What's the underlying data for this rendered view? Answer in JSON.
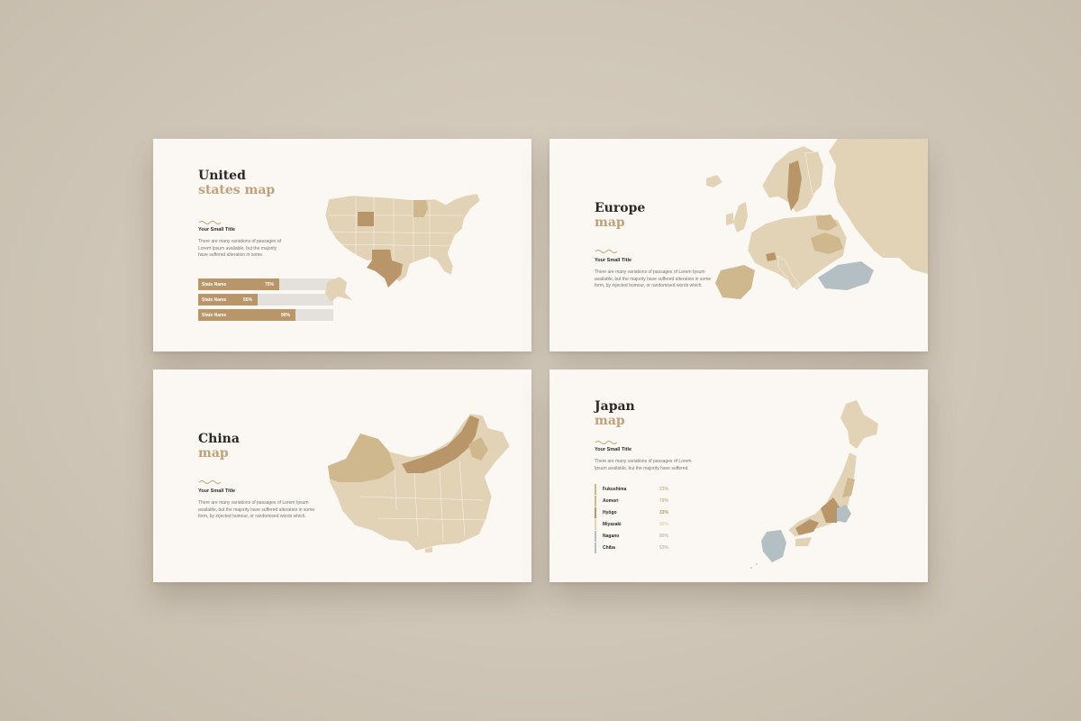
{
  "colors": {
    "background": "#d3cabb",
    "slide": "#fbf8f3",
    "map_light": "#e2d3b6",
    "map_mid": "#cfb78e",
    "map_dark": "#b8966a",
    "map_blue": "#b3bfc3",
    "title_dark": "#2d2824",
    "title_gold": "#bfa27a"
  },
  "slides": {
    "us": {
      "title_line1": "United",
      "title_line2": "states map",
      "small_title": "Your Small Title",
      "body": "There are many variations of passages of Lorem Ipsum available, but the majority have suffered alteration in some.",
      "bars": [
        {
          "label": "State Name",
          "pct_text": "75%",
          "value": 0.75
        },
        {
          "label": "State Name",
          "pct_text": "55%",
          "value": 0.55
        },
        {
          "label": "State Name",
          "pct_text": "90%",
          "value": 0.9
        }
      ]
    },
    "europe": {
      "title_line1": "Europe",
      "title_line2": "map",
      "small_title": "Your Small Title",
      "body": "There are many variations of passages of Lorem Ipsum available, but the majority have suffered alteration in some form, by injected humour, or randomised words which."
    },
    "china": {
      "title_line1": "China",
      "title_line2": "map",
      "small_title": "Your Small Title",
      "body": "There are many variations of passages of Lorem Ipsum available, but the majority have suffered alteration in some form, by injected humour, or randomised words which."
    },
    "japan": {
      "title_line1": "Japan",
      "title_line2": "map",
      "small_title": "Your Small Title",
      "body": "There are many variations of passages of Lorem Ipsum available, but the majority have suffered.",
      "legend": [
        {
          "name": "Fukushima",
          "pct": "23%",
          "color": "#cfb78e"
        },
        {
          "name": "Aomori",
          "pct": "79%",
          "color": "#cfb78e"
        },
        {
          "name": "Hyōgo",
          "pct": "33%",
          "color": "#b8966a"
        },
        {
          "name": "Miyazaki",
          "pct": "90%",
          "color": "#e2d3b6"
        },
        {
          "name": "Nagano",
          "pct": "80%",
          "color": "#b3bfc3"
        },
        {
          "name": "Chiba",
          "pct": "53%",
          "color": "#b3bfc3"
        }
      ]
    }
  }
}
